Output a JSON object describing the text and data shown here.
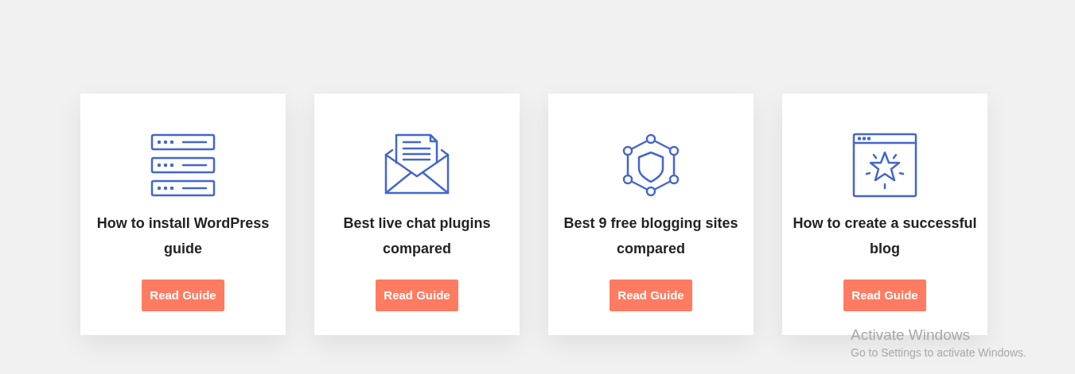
{
  "cards": [
    {
      "title": "How to install WordPress guide",
      "button": "Read Guide"
    },
    {
      "title": "Best live chat plugins compared",
      "button": "Read Guide"
    },
    {
      "title": "Best 9 free blogging sites compared",
      "button": "Read Guide"
    },
    {
      "title": "How to create a successful blog",
      "button": "Read Guide"
    }
  ],
  "activation_notice": {
    "title": "Activate Windows",
    "subtitle": "Go to Settings to activate Windows."
  }
}
